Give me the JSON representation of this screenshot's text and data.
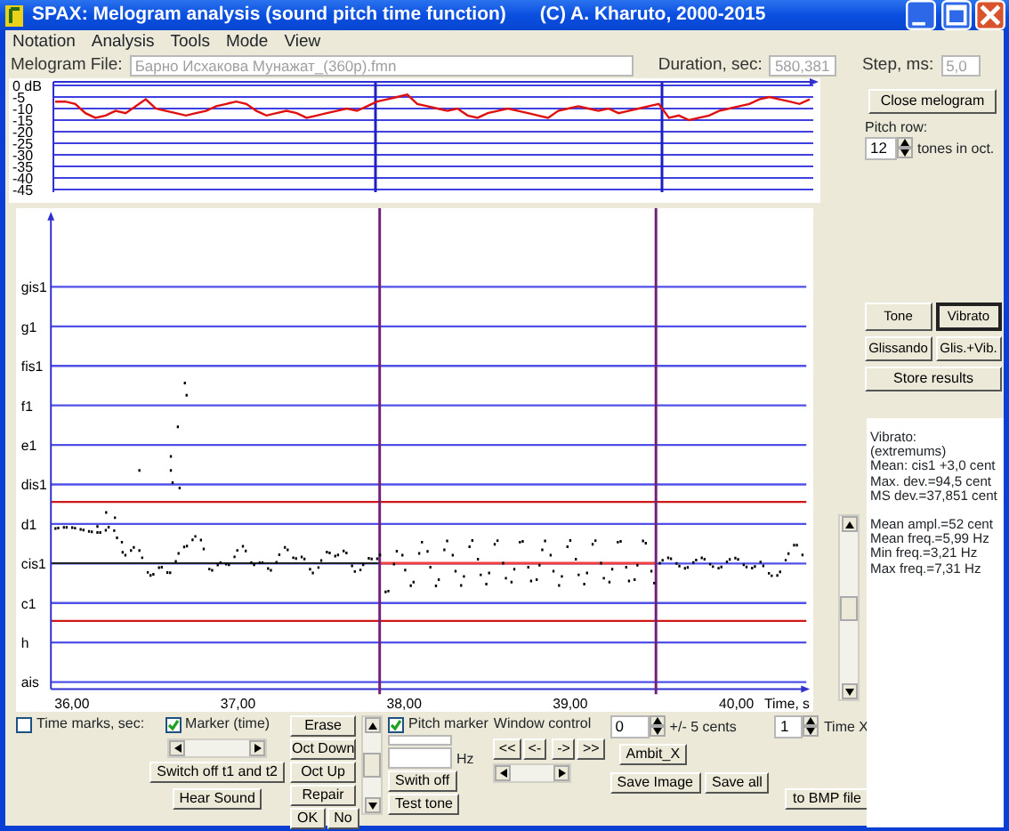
{
  "window": {
    "title": "SPAX: Melogram analysis (sound pitch time function)",
    "copyright": "(C) A. Kharuto, 2000-2015"
  },
  "menu": [
    "Notation",
    "Analysis",
    "Tools",
    "Mode",
    "View"
  ],
  "file": {
    "label": "Melogram File:",
    "value": "Барно Исхакова Мунажат_(360p).fmn",
    "duration_label": "Duration, sec:",
    "duration": "580,381",
    "step_label": "Step, ms:",
    "step": "5,0"
  },
  "level_chart": {
    "chart_data": {
      "type": "line",
      "grid": true,
      "ylim": [
        -45,
        0
      ],
      "yticks": [
        {
          "value": 0,
          "label": "0 dB"
        },
        -5,
        -10,
        -15,
        -20,
        -25,
        -30,
        -35,
        -40,
        -45
      ],
      "series": [
        {
          "color": "#e01010",
          "values": [
            -7,
            -7,
            -8,
            -12,
            -14,
            -13,
            -11,
            -12,
            -9,
            -6,
            -10,
            -11,
            -12,
            -13,
            -12,
            -11,
            -9,
            -8,
            -7,
            -8,
            -11,
            -13,
            -12,
            -11,
            -12,
            -14,
            -13,
            -12,
            -11,
            -10,
            -11,
            -9,
            -7,
            -6,
            -5,
            -4,
            -8,
            -9,
            -10,
            -11,
            -10,
            -13,
            -14,
            -12,
            -11,
            -10,
            -11,
            -12,
            -13,
            -14,
            -11,
            -10,
            -9,
            -10,
            -11,
            -10,
            -12,
            -11,
            -10,
            -9,
            -8,
            -14,
            -13,
            -15,
            -14,
            -13,
            -11,
            -10,
            -9,
            -8,
            -6,
            -5,
            -6,
            -7,
            -8,
            -6
          ]
        }
      ]
    }
  },
  "pitch_chart": {
    "y_labels": [
      "gis1",
      "g1",
      "fis1",
      "f1",
      "e1",
      "dis1",
      "d1",
      "cis1",
      "c1",
      "h",
      "ais"
    ],
    "x_labels": [
      "36,00",
      "37,00",
      "38,00",
      "39,00",
      "40,00"
    ],
    "x_title": "Time, s"
  },
  "side": {
    "close_button": "Close melogram",
    "pitch_row_label": "Pitch row:",
    "pitch_row_value": "12",
    "pitch_row_unit": "tones in oct.",
    "mode_buttons": [
      {
        "label": "Tone",
        "selected": false
      },
      {
        "label": "Vibrato",
        "selected": true
      },
      {
        "label": "Glissando",
        "selected": false
      },
      {
        "label": "Glis.+Vib.",
        "selected": false
      }
    ],
    "store_button": "Store results",
    "results": [
      [
        "Vibrato:",
        "(extremums)",
        "Mean: cis1 +3,0 cent",
        "Max. dev.=94,5 cent",
        "MS dev.=37,851 cent"
      ],
      [
        "Mean ampl.=52 cent",
        "Mean freq.=5,99 Hz",
        "Min freq.=3,21 Hz",
        "Max freq.=7,31 Hz"
      ]
    ]
  },
  "controls": {
    "time_marks": {
      "label": "Time marks, sec:",
      "checked": false
    },
    "marker_time": {
      "label": "Marker (time)",
      "checked": true
    },
    "switch_off_button": "Switch off t1 and t2",
    "hear_sound_button": "Hear Sound",
    "edit_buttons": [
      "Erase",
      "Oct Down",
      "Oct Up",
      "Repair"
    ],
    "ok_button": "OK",
    "no_button": "No",
    "pitch_marker": {
      "label": "Pitch marker",
      "checked": true
    },
    "hz_label": "Hz",
    "swith_off_button": "Swith off",
    "test_tone_button": "Test tone",
    "window_control_label": "Window control",
    "window_buttons": [
      "<<",
      "<-",
      "->",
      ">>"
    ],
    "cents_value": "0",
    "cents_label": "+/- 5 cents",
    "ambit_button": "Ambit_X",
    "time_x_value": "1",
    "time_x_label": "Time X",
    "save_image_button": "Save Image",
    "save_all_button": "Save all",
    "bmp_button": "to BMP file"
  }
}
